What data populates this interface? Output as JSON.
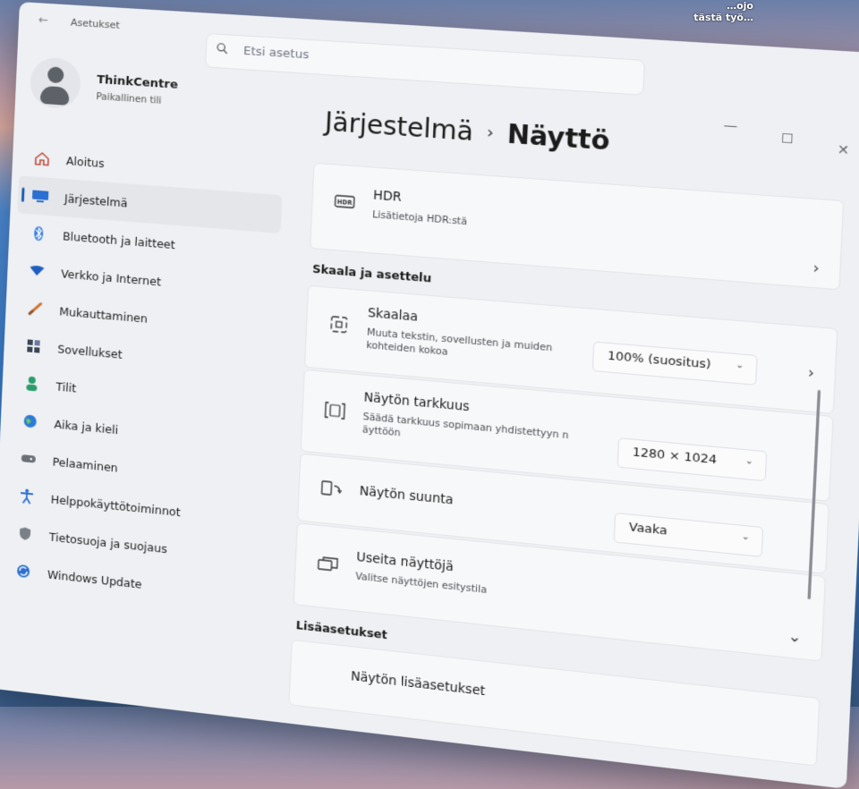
{
  "desktop": {
    "corner_text": [
      "…ojo",
      "tästä työ…"
    ]
  },
  "window": {
    "app_title": "Asetukset",
    "search_placeholder": "Etsi asetus",
    "controls": {
      "minimize": "—",
      "maximize": "☐",
      "close": "✕"
    }
  },
  "profile": {
    "name": "ThinkCentre",
    "account": "Paikallinen tili"
  },
  "sidebar": {
    "items": [
      {
        "label": "Aloitus",
        "icon": "home-icon",
        "color": "#c24c3c"
      },
      {
        "label": "Järjestelmä",
        "icon": "display-icon",
        "color": "#1f5fb8",
        "active": true
      },
      {
        "label": "Bluetooth ja laitteet",
        "icon": "bluetooth-icon",
        "color": "#2b6fd0"
      },
      {
        "label": "Verkko ja Internet",
        "icon": "wifi-icon",
        "color": "#1e4fa8"
      },
      {
        "label": "Mukauttaminen",
        "icon": "brush-icon",
        "color": "#d2722e"
      },
      {
        "label": "Sovellukset",
        "icon": "apps-icon",
        "color": "#3c4656"
      },
      {
        "label": "Tilit",
        "icon": "person-icon",
        "color": "#2a9d6a"
      },
      {
        "label": "Aika ja kieli",
        "icon": "globe-icon",
        "color": "#2b7bd6"
      },
      {
        "label": "Pelaaminen",
        "icon": "gamepad-icon",
        "color": "#6b7078"
      },
      {
        "label": "Helppokäyttötoiminnot",
        "icon": "accessibility-icon",
        "color": "#2b6fd0"
      },
      {
        "label": "Tietosuoja ja suojaus",
        "icon": "shield-icon",
        "color": "#6b7078"
      },
      {
        "label": "Windows Update",
        "icon": "update-icon",
        "color": "#2b6fd0"
      }
    ]
  },
  "breadcrumb": {
    "parent": "Järjestelmä",
    "separator": "›",
    "current": "Näyttö"
  },
  "cards": {
    "hdr": {
      "icon_text": "HDR",
      "title": "HDR",
      "desc": "Lisätietoja HDR:stä"
    },
    "scale": {
      "title": "Skaalaa",
      "desc": "Muuta tekstin, sovellusten ja muiden kohteiden kokoa",
      "value": "100% (suositus)"
    },
    "resolution": {
      "title": "Näytön tarkkuus",
      "desc": "Säädä tarkkuus sopimaan yhdistettyyn n äyttöön",
      "value": "1280 × 1024"
    },
    "orientation": {
      "title": "Näytön suunta",
      "value": "Vaaka"
    },
    "multi": {
      "title": "Useita näyttöjä",
      "desc": "Valitse näyttöjen esitystila"
    },
    "advanced": {
      "title": "Näytön lisäasetukset"
    }
  },
  "sections": {
    "scale_layout": "Skaala ja asettelu",
    "more": "Lisäasetukset"
  }
}
